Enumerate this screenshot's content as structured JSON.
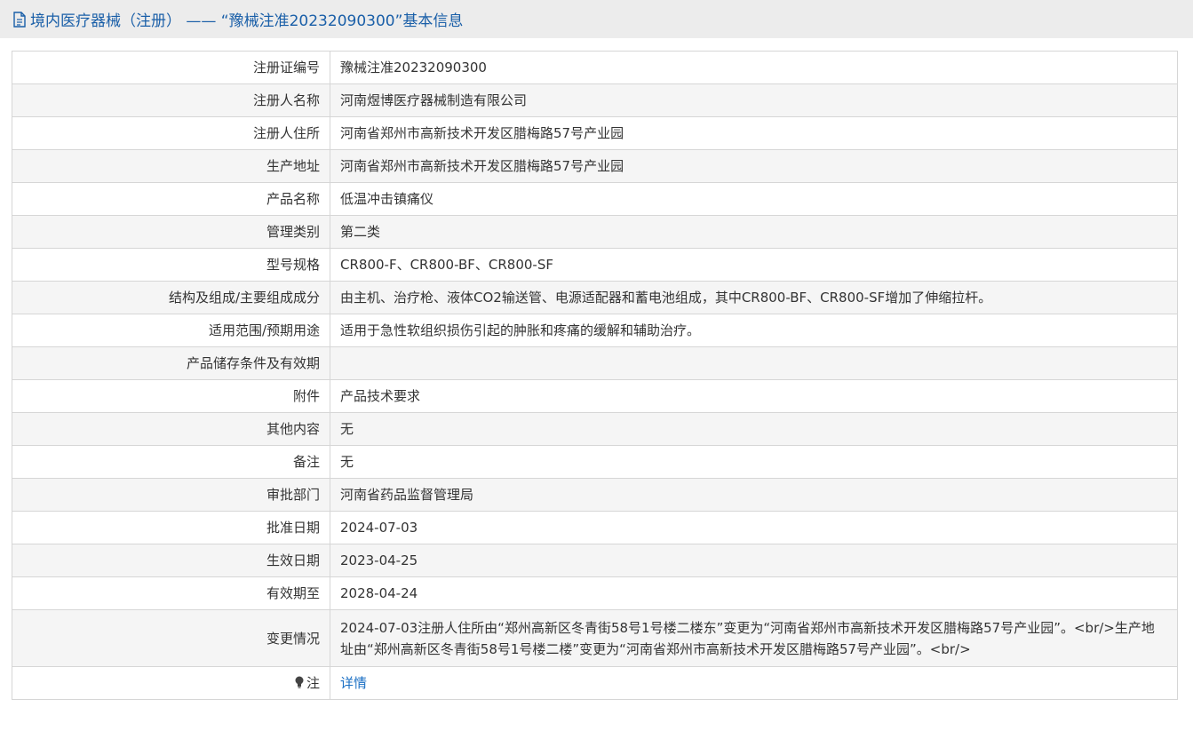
{
  "header": {
    "title": "境内医疗器械（注册） —— “豫械注准20232090300”基本信息",
    "icon": "document-icon",
    "color": "#1a5fa8"
  },
  "rows": [
    {
      "label": "注册证编号",
      "value": "豫械注准20232090300"
    },
    {
      "label": "注册人名称",
      "value": "河南煜博医疗器械制造有限公司"
    },
    {
      "label": "注册人住所",
      "value": "河南省郑州市高新技术开发区腊梅路57号产业园"
    },
    {
      "label": "生产地址",
      "value": "河南省郑州市高新技术开发区腊梅路57号产业园"
    },
    {
      "label": "产品名称",
      "value": "低温冲击镇痛仪"
    },
    {
      "label": "管理类别",
      "value": "第二类"
    },
    {
      "label": "型号规格",
      "value": "CR800-F、CR800-BF、CR800-SF"
    },
    {
      "label": "结构及组成/主要组成成分",
      "value": "由主机、治疗枪、液体CO2输送管、电源适配器和蓄电池组成，其中CR800-BF、CR800-SF增加了伸缩拉杆。"
    },
    {
      "label": "适用范围/预期用途",
      "value": "适用于急性软组织损伤引起的肿胀和疼痛的缓解和辅助治疗。"
    },
    {
      "label": "产品储存条件及有效期",
      "value": ""
    },
    {
      "label": "附件",
      "value": "产品技术要求"
    },
    {
      "label": "其他内容",
      "value": "无"
    },
    {
      "label": "备注",
      "value": "无"
    },
    {
      "label": "审批部门",
      "value": "河南省药品监督管理局"
    },
    {
      "label": "批准日期",
      "value": "2024-07-03"
    },
    {
      "label": "生效日期",
      "value": "2023-04-25"
    },
    {
      "label": "有效期至",
      "value": "2028-04-24"
    },
    {
      "label": "变更情况",
      "value": "2024-07-03注册人住所由“郑州高新区冬青街58号1号楼二楼东”变更为“河南省郑州市高新技术开发区腊梅路57号产业园”。<br/>生产地址由“郑州高新区冬青街58号1号楼二楼”变更为“河南省郑州市高新技术开发区腊梅路57号产业园”。<br/>"
    }
  ],
  "note": {
    "label": "注",
    "link_text": "详情",
    "icon": "lightbulb-icon"
  }
}
